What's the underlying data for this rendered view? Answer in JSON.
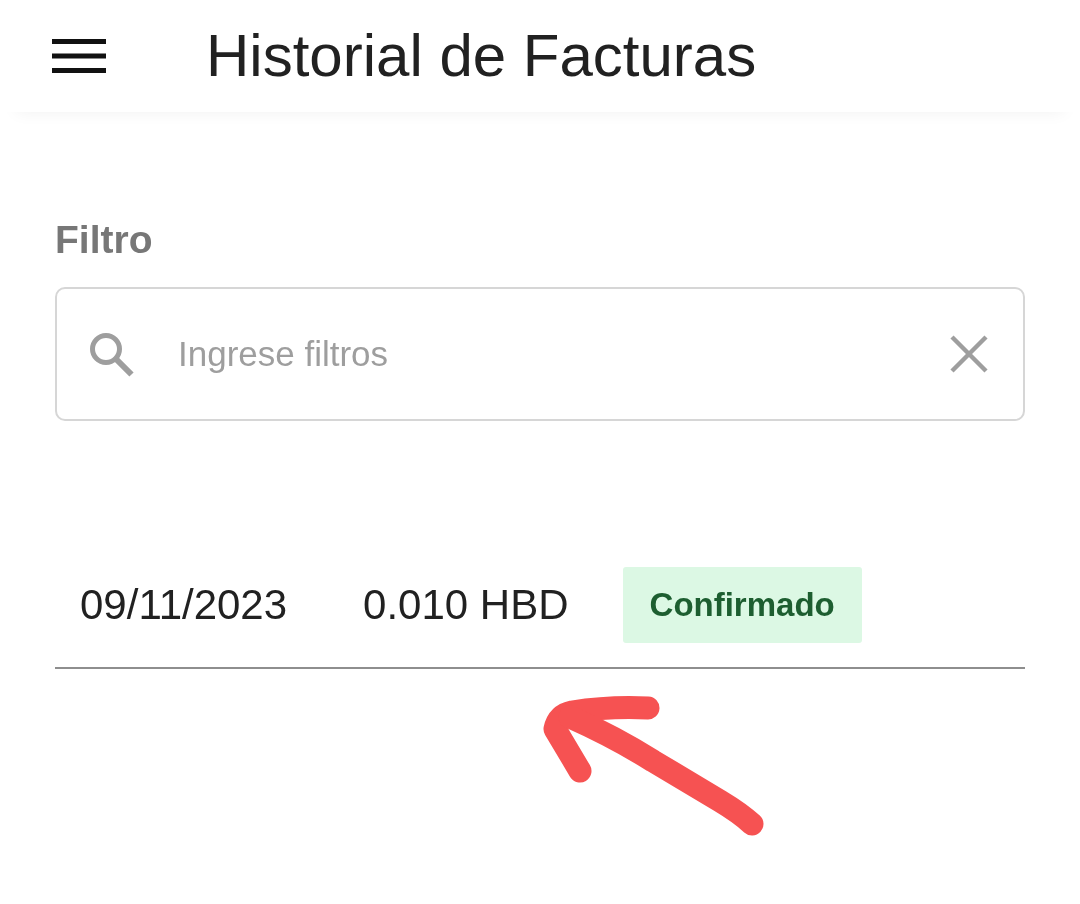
{
  "header": {
    "title": "Historial de Facturas"
  },
  "filter": {
    "label": "Filtro",
    "placeholder": "Ingrese filtros"
  },
  "invoices": [
    {
      "date": "09/11/2023",
      "amount": "0.010 HBD",
      "status": "Confirmado"
    }
  ]
}
